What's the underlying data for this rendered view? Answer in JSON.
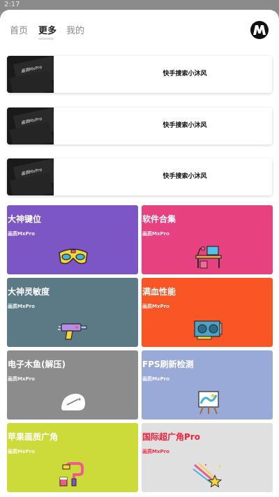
{
  "status_bar": {
    "time": "2:17"
  },
  "nav": {
    "tabs": [
      {
        "label": "首页",
        "active": false
      },
      {
        "label": "更多",
        "active": true
      },
      {
        "label": "我的",
        "active": false
      }
    ],
    "logo_letter": "M"
  },
  "banners": [
    {
      "thumb_text": "画质MxPro",
      "text": "快手搜索小沐风"
    },
    {
      "thumb_text": "画质MxPro",
      "text": "快手搜索小沐风"
    },
    {
      "thumb_text": "画质MxPro",
      "text": "快手搜索小沐风"
    }
  ],
  "tiles": [
    {
      "title": "大神键位",
      "subtitle": "画质MxPro",
      "icon": "vr-goggles-icon",
      "color": "#7c56c4",
      "title_color": "#ffffff"
    },
    {
      "title": "软件合集",
      "subtitle": "画质MxPro",
      "icon": "desk-computer-icon",
      "color": "#e8417f",
      "title_color": "#ffffff"
    },
    {
      "title": "大神灵敏度",
      "subtitle": "画质MxPro",
      "icon": "drill-tool-icon",
      "color": "#5c7a86",
      "title_color": "#ffffff"
    },
    {
      "title": "满血性能",
      "subtitle": "画质MxPro",
      "icon": "graphics-card-icon",
      "color": "#fa5524",
      "title_color": "#ffffff"
    },
    {
      "title": "电子木鱼(解压)",
      "subtitle": "画质MxPro",
      "icon": "wooden-fish-icon",
      "color": "#8c8c8c",
      "title_color": "#ffffff"
    },
    {
      "title": "FPS刷新检测",
      "subtitle": "画质MxPro",
      "icon": "easel-icon",
      "color": "#9aaad8",
      "title_color": "#ffffff"
    },
    {
      "title": "苹果画质广角",
      "subtitle": "画质MxPro",
      "icon": "paint-roller-icon",
      "color": "#cddb3a",
      "title_color": "#ffffff"
    },
    {
      "title": "国际超广角Pro",
      "subtitle": "画质MxPro",
      "icon": "shooting-star-icon",
      "color": "#e0e0e0",
      "title_color": "#f3213c"
    }
  ]
}
